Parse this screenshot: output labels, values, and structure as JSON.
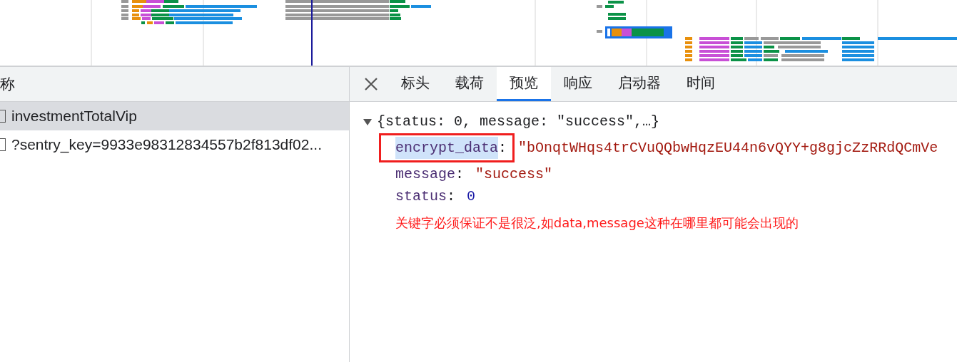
{
  "requests": {
    "column_header": "称",
    "rows": [
      {
        "name": "investmentTotalVip",
        "selected": true
      },
      {
        "name": "?sentry_key=9933e98312834557b2f813df02...",
        "selected": false
      }
    ]
  },
  "detail": {
    "tabs": [
      {
        "label": "标头",
        "selected": false
      },
      {
        "label": "载荷",
        "selected": false
      },
      {
        "label": "预览",
        "selected": true
      },
      {
        "label": "响应",
        "selected": false
      },
      {
        "label": "启动器",
        "selected": false
      },
      {
        "label": "时间",
        "selected": false
      }
    ],
    "preview": {
      "summary": "{status: 0, message: \"success\",…}",
      "expanded": true,
      "properties": [
        {
          "key": "encrypt_data",
          "value": "\"bOnqtWHqs4trCVuQQbwHqzEU44n6vQYY+g8gjcZzRRdQCmVe",
          "kind": "string",
          "highlighted": true,
          "separator": ":"
        },
        {
          "key": "message",
          "value": "\"success\"",
          "kind": "string",
          "highlighted": false,
          "separator": ":"
        },
        {
          "key": "status",
          "value": "0",
          "kind": "number",
          "highlighted": false,
          "separator": ":"
        }
      ]
    },
    "annotation": "关键字必须保证不是很泛,如data,message这种在哪里都可能会出现的"
  }
}
